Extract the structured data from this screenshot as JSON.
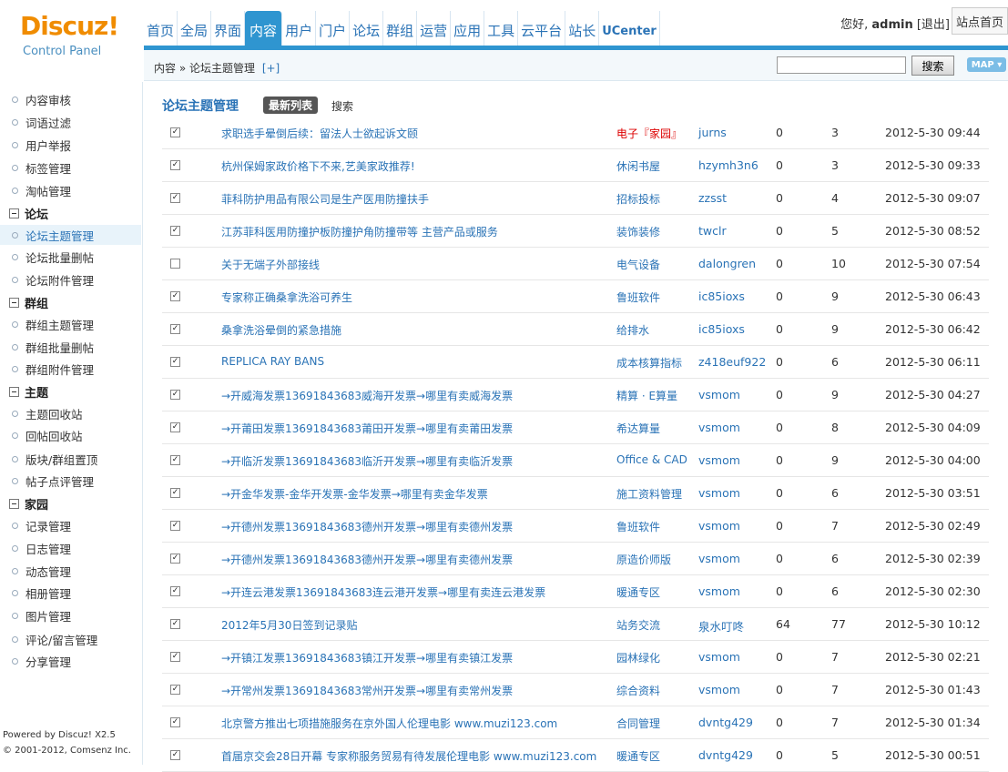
{
  "header": {
    "logo_word": "Discuz!",
    "logo_sub": "Control Panel",
    "nav": [
      "首页",
      "全局",
      "界面",
      "内容",
      "用户",
      "门户",
      "论坛",
      "群组",
      "运营",
      "应用",
      "工具",
      "云平台",
      "站长",
      "UCenter"
    ],
    "active_nav": "内容",
    "greeting": "您好,",
    "username": "admin",
    "logout": "[退出]",
    "site_home": "站点首页"
  },
  "crumb": {
    "path": "内容 » 论坛主题管理",
    "add": "[+]",
    "search_placeholder": "",
    "search_button": "搜索",
    "map_button": "MAP ▾"
  },
  "sidebar": {
    "entries": [
      {
        "type": "item",
        "label": "内容审核"
      },
      {
        "type": "item",
        "label": "词语过滤"
      },
      {
        "type": "item",
        "label": "用户举报"
      },
      {
        "type": "item",
        "label": "标签管理"
      },
      {
        "type": "item",
        "label": "淘帖管理"
      },
      {
        "type": "group",
        "label": "论坛"
      },
      {
        "type": "item",
        "label": "论坛主题管理",
        "active": true
      },
      {
        "type": "item",
        "label": "论坛批量删帖"
      },
      {
        "type": "item",
        "label": "论坛附件管理"
      },
      {
        "type": "group",
        "label": "群组"
      },
      {
        "type": "item",
        "label": "群组主题管理"
      },
      {
        "type": "item",
        "label": "群组批量删帖"
      },
      {
        "type": "item",
        "label": "群组附件管理"
      },
      {
        "type": "group",
        "label": "主题"
      },
      {
        "type": "item",
        "label": "主题回收站"
      },
      {
        "type": "item",
        "label": "回帖回收站"
      },
      {
        "type": "item",
        "label": "版块/群组置顶"
      },
      {
        "type": "item",
        "label": "帖子点评管理"
      },
      {
        "type": "group",
        "label": "家园"
      },
      {
        "type": "item",
        "label": "记录管理"
      },
      {
        "type": "item",
        "label": "日志管理"
      },
      {
        "type": "item",
        "label": "动态管理"
      },
      {
        "type": "item",
        "label": "相册管理"
      },
      {
        "type": "item",
        "label": "图片管理"
      },
      {
        "type": "item",
        "label": "评论/留言管理"
      },
      {
        "type": "item",
        "label": "分享管理"
      }
    ],
    "power": "Powered by Discuz! X2.5",
    "copyright": "© 2001-2012, Comsenz Inc."
  },
  "main": {
    "title": "论坛主题管理",
    "tab_latest": "最新列表",
    "tab_search": "搜索",
    "rows": [
      {
        "checked": true,
        "title": "求职选手晕倒后续：留法人士欲起诉文颐",
        "forum": "电子『家园』",
        "forum_red": true,
        "author": "jurns",
        "replies": "0",
        "views": "3",
        "time": "2012-5-30 09:44"
      },
      {
        "checked": true,
        "title": "杭州保姆家政价格下不来,艺美家政推荐!",
        "forum": "休闲书屋",
        "author": "hzymh3n6",
        "replies": "0",
        "views": "3",
        "time": "2012-5-30 09:33"
      },
      {
        "checked": true,
        "title": "菲科防护用品有限公司是生产医用防撞扶手",
        "forum": "招标投标",
        "author": "zzsst",
        "replies": "0",
        "views": "4",
        "time": "2012-5-30 09:07"
      },
      {
        "checked": true,
        "title": "江苏菲科医用防撞护板防撞护角防撞带等 主营产品或服务",
        "forum": "装饰装修",
        "author": "twclr",
        "replies": "0",
        "views": "5",
        "time": "2012-5-30 08:52"
      },
      {
        "checked": false,
        "title": "关于无端子外部接线",
        "forum": "电气设备",
        "author": "dalongren",
        "replies": "0",
        "views": "10",
        "time": "2012-5-30 07:54"
      },
      {
        "checked": true,
        "title": "专家称正确桑拿洗浴可养生",
        "forum": "鲁班软件",
        "author": "ic85ioxs",
        "replies": "0",
        "views": "9",
        "time": "2012-5-30 06:43"
      },
      {
        "checked": true,
        "title": "桑拿洗浴晕倒的紧急措施",
        "forum": "给排水",
        "author": "ic85ioxs",
        "replies": "0",
        "views": "9",
        "time": "2012-5-30 06:42"
      },
      {
        "checked": true,
        "title": "REPLICA RAY BANS",
        "forum": "成本核算指标",
        "author": "z418euf922",
        "replies": "0",
        "views": "6",
        "time": "2012-5-30 06:11"
      },
      {
        "checked": true,
        "title": "→开威海发票13691843683威海开发票→哪里有卖威海发票",
        "forum": "精算 · E算量",
        "author": "vsmom",
        "replies": "0",
        "views": "9",
        "time": "2012-5-30 04:27"
      },
      {
        "checked": true,
        "title": "→开莆田发票13691843683莆田开发票→哪里有卖莆田发票",
        "forum": "希达算量",
        "author": "vsmom",
        "replies": "0",
        "views": "8",
        "time": "2012-5-30 04:09"
      },
      {
        "checked": true,
        "title": "→开临沂发票13691843683临沂开发票→哪里有卖临沂发票",
        "forum": "Office & CAD",
        "author": "vsmom",
        "replies": "0",
        "views": "9",
        "time": "2012-5-30 04:00"
      },
      {
        "checked": true,
        "title": "→开金华发票-金华开发票-金华发票→哪里有卖金华发票",
        "forum": "施工资料管理",
        "author": "vsmom",
        "replies": "0",
        "views": "6",
        "time": "2012-5-30 03:51"
      },
      {
        "checked": true,
        "title": "→开德州发票13691843683德州开发票→哪里有卖德州发票",
        "forum": "鲁班软件",
        "author": "vsmom",
        "replies": "0",
        "views": "7",
        "time": "2012-5-30 02:49"
      },
      {
        "checked": true,
        "title": "→开德州发票13691843683德州开发票→哪里有卖德州发票",
        "forum": "原造价师版",
        "author": "vsmom",
        "replies": "0",
        "views": "6",
        "time": "2012-5-30 02:39"
      },
      {
        "checked": true,
        "title": "→开连云港发票13691843683连云港开发票→哪里有卖连云港发票",
        "forum": "暖通专区",
        "author": "vsmom",
        "replies": "0",
        "views": "6",
        "time": "2012-5-30 02:30"
      },
      {
        "checked": true,
        "title": "2012年5月30日签到记录贴",
        "forum": "站务交流",
        "author": "泉水叮咚",
        "replies": "64",
        "views": "77",
        "time": "2012-5-30 10:12"
      },
      {
        "checked": true,
        "title": "→开镇江发票13691843683镇江开发票→哪里有卖镇江发票",
        "forum": "园林绿化",
        "author": "vsmom",
        "replies": "0",
        "views": "7",
        "time": "2012-5-30 02:21"
      },
      {
        "checked": true,
        "title": "→开常州发票13691843683常州开发票→哪里有卖常州发票",
        "forum": "综合资料",
        "author": "vsmom",
        "replies": "0",
        "views": "7",
        "time": "2012-5-30 01:43"
      },
      {
        "checked": true,
        "title": "北京警方推出七项措施服务在京外国人伦理电影 www.muzi123.com",
        "forum": "合同管理",
        "author": "dvntg429",
        "replies": "0",
        "views": "7",
        "time": "2012-5-30 01:34"
      },
      {
        "checked": true,
        "title": "首届京交会28日开幕 专家称服务贸易有待发展伦理电影 www.muzi123.com",
        "forum": "暖通专区",
        "author": "dvntg429",
        "replies": "0",
        "views": "5",
        "time": "2012-5-30 00:51"
      }
    ]
  }
}
